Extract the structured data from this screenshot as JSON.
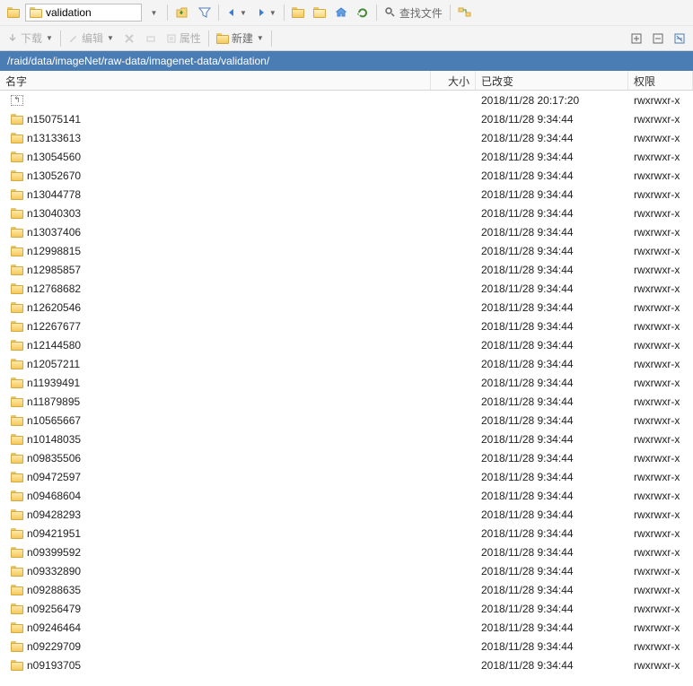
{
  "toolbar": {
    "path_value": "validation",
    "download_label": "下载",
    "edit_label": "编辑",
    "props_label": "属性",
    "new_label": "新建",
    "find_label": "查找文件"
  },
  "path_bar": "/raid/data/imageNet/raw-data/imagenet-data/validation/",
  "columns": {
    "name": "名字",
    "size": "大小",
    "changed": "已改变",
    "perm": "权限"
  },
  "files": [
    {
      "name": "..",
      "up": true,
      "size": "",
      "changed": "2018/11/28 20:17:20",
      "perm": "rwxrwxr-x"
    },
    {
      "name": "n15075141",
      "size": "",
      "changed": "2018/11/28 9:34:44",
      "perm": "rwxrwxr-x"
    },
    {
      "name": "n13133613",
      "size": "",
      "changed": "2018/11/28 9:34:44",
      "perm": "rwxrwxr-x"
    },
    {
      "name": "n13054560",
      "size": "",
      "changed": "2018/11/28 9:34:44",
      "perm": "rwxrwxr-x"
    },
    {
      "name": "n13052670",
      "size": "",
      "changed": "2018/11/28 9:34:44",
      "perm": "rwxrwxr-x"
    },
    {
      "name": "n13044778",
      "size": "",
      "changed": "2018/11/28 9:34:44",
      "perm": "rwxrwxr-x"
    },
    {
      "name": "n13040303",
      "size": "",
      "changed": "2018/11/28 9:34:44",
      "perm": "rwxrwxr-x"
    },
    {
      "name": "n13037406",
      "size": "",
      "changed": "2018/11/28 9:34:44",
      "perm": "rwxrwxr-x"
    },
    {
      "name": "n12998815",
      "size": "",
      "changed": "2018/11/28 9:34:44",
      "perm": "rwxrwxr-x"
    },
    {
      "name": "n12985857",
      "size": "",
      "changed": "2018/11/28 9:34:44",
      "perm": "rwxrwxr-x"
    },
    {
      "name": "n12768682",
      "size": "",
      "changed": "2018/11/28 9:34:44",
      "perm": "rwxrwxr-x"
    },
    {
      "name": "n12620546",
      "size": "",
      "changed": "2018/11/28 9:34:44",
      "perm": "rwxrwxr-x"
    },
    {
      "name": "n12267677",
      "size": "",
      "changed": "2018/11/28 9:34:44",
      "perm": "rwxrwxr-x"
    },
    {
      "name": "n12144580",
      "size": "",
      "changed": "2018/11/28 9:34:44",
      "perm": "rwxrwxr-x"
    },
    {
      "name": "n12057211",
      "size": "",
      "changed": "2018/11/28 9:34:44",
      "perm": "rwxrwxr-x"
    },
    {
      "name": "n11939491",
      "size": "",
      "changed": "2018/11/28 9:34:44",
      "perm": "rwxrwxr-x"
    },
    {
      "name": "n11879895",
      "size": "",
      "changed": "2018/11/28 9:34:44",
      "perm": "rwxrwxr-x"
    },
    {
      "name": "n10565667",
      "size": "",
      "changed": "2018/11/28 9:34:44",
      "perm": "rwxrwxr-x"
    },
    {
      "name": "n10148035",
      "size": "",
      "changed": "2018/11/28 9:34:44",
      "perm": "rwxrwxr-x"
    },
    {
      "name": "n09835506",
      "size": "",
      "changed": "2018/11/28 9:34:44",
      "perm": "rwxrwxr-x"
    },
    {
      "name": "n09472597",
      "size": "",
      "changed": "2018/11/28 9:34:44",
      "perm": "rwxrwxr-x"
    },
    {
      "name": "n09468604",
      "size": "",
      "changed": "2018/11/28 9:34:44",
      "perm": "rwxrwxr-x"
    },
    {
      "name": "n09428293",
      "size": "",
      "changed": "2018/11/28 9:34:44",
      "perm": "rwxrwxr-x"
    },
    {
      "name": "n09421951",
      "size": "",
      "changed": "2018/11/28 9:34:44",
      "perm": "rwxrwxr-x"
    },
    {
      "name": "n09399592",
      "size": "",
      "changed": "2018/11/28 9:34:44",
      "perm": "rwxrwxr-x"
    },
    {
      "name": "n09332890",
      "size": "",
      "changed": "2018/11/28 9:34:44",
      "perm": "rwxrwxr-x"
    },
    {
      "name": "n09288635",
      "size": "",
      "changed": "2018/11/28 9:34:44",
      "perm": "rwxrwxr-x"
    },
    {
      "name": "n09256479",
      "size": "",
      "changed": "2018/11/28 9:34:44",
      "perm": "rwxrwxr-x"
    },
    {
      "name": "n09246464",
      "size": "",
      "changed": "2018/11/28 9:34:44",
      "perm": "rwxrwxr-x"
    },
    {
      "name": "n09229709",
      "size": "",
      "changed": "2018/11/28 9:34:44",
      "perm": "rwxrwxr-x"
    },
    {
      "name": "n09193705",
      "size": "",
      "changed": "2018/11/28 9:34:44",
      "perm": "rwxrwxr-x"
    }
  ]
}
